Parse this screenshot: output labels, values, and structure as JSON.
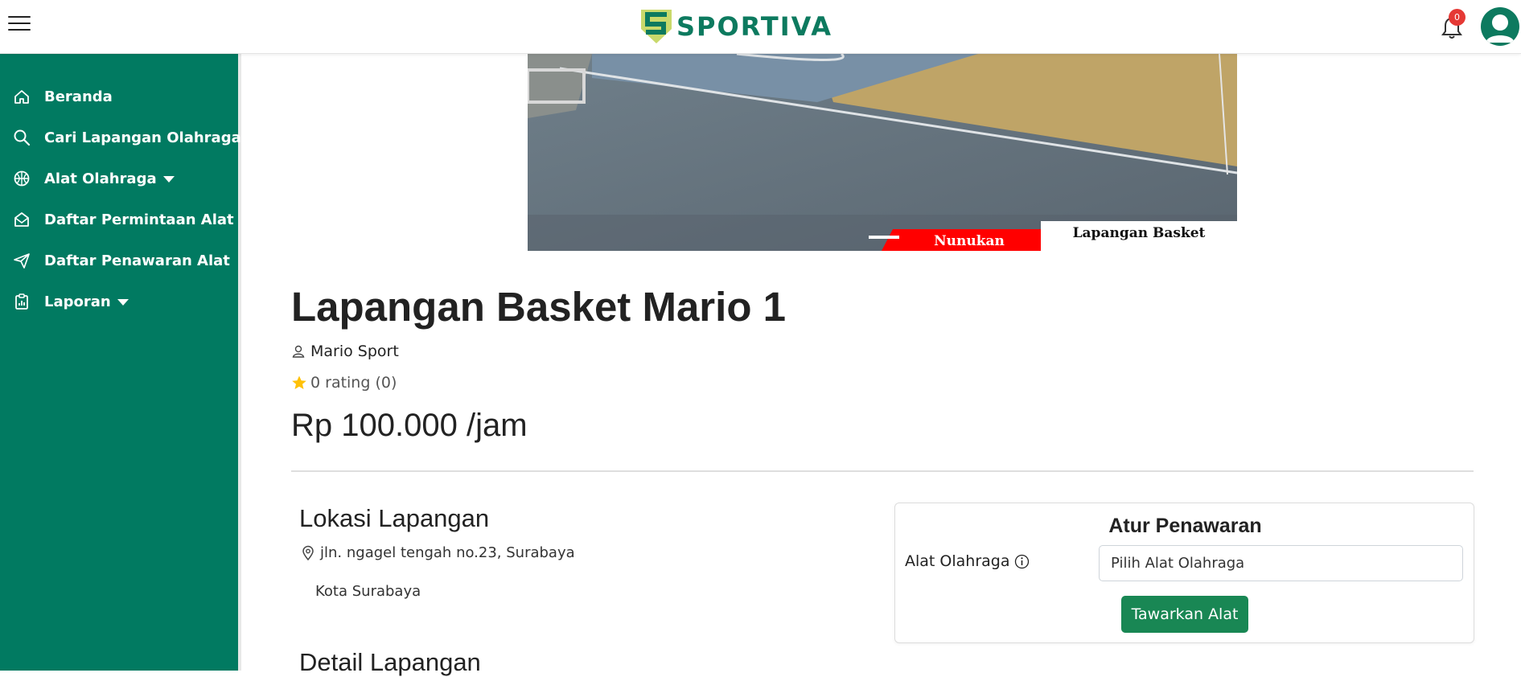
{
  "brand": {
    "name": "SPORTIVA"
  },
  "notifications": {
    "count": "0"
  },
  "sidebar": {
    "items": [
      {
        "label": "Beranda",
        "icon": "home-icon"
      },
      {
        "label": "Cari Lapangan Olahraga",
        "icon": "search-icon"
      },
      {
        "label": "Alat Olahraga",
        "icon": "basketball-icon",
        "has_dropdown": true
      },
      {
        "label": "Daftar Permintaan Alat",
        "icon": "envelope-open-icon"
      },
      {
        "label": "Daftar Penawaran Alat",
        "icon": "send-icon"
      },
      {
        "label": "Laporan",
        "icon": "clipboard-data-icon",
        "has_dropdown": true
      }
    ]
  },
  "hero": {
    "city": "Nunukan",
    "caption": "Lapangan Basket"
  },
  "field": {
    "title": "Lapangan Basket Mario 1",
    "owner": "Mario Sport",
    "rating": "0 rating (0)",
    "price": "Rp 100.000 /jam"
  },
  "location": {
    "title": "Lokasi Lapangan",
    "address": "jln. ngagel tengah no.23, Surabaya",
    "city": "Kota Surabaya"
  },
  "detail": {
    "title": "Detail Lapangan"
  },
  "offer": {
    "title": "Atur Penawaran",
    "label": "Alat Olahraga",
    "select_value": "Pilih Alat Olahraga",
    "button_label": "Tawarkan Alat"
  },
  "colors": {
    "primary": "#017a61",
    "button": "#198754",
    "badge": "#e53935",
    "banner_red": "#ff0000",
    "star": "#ffc107"
  }
}
